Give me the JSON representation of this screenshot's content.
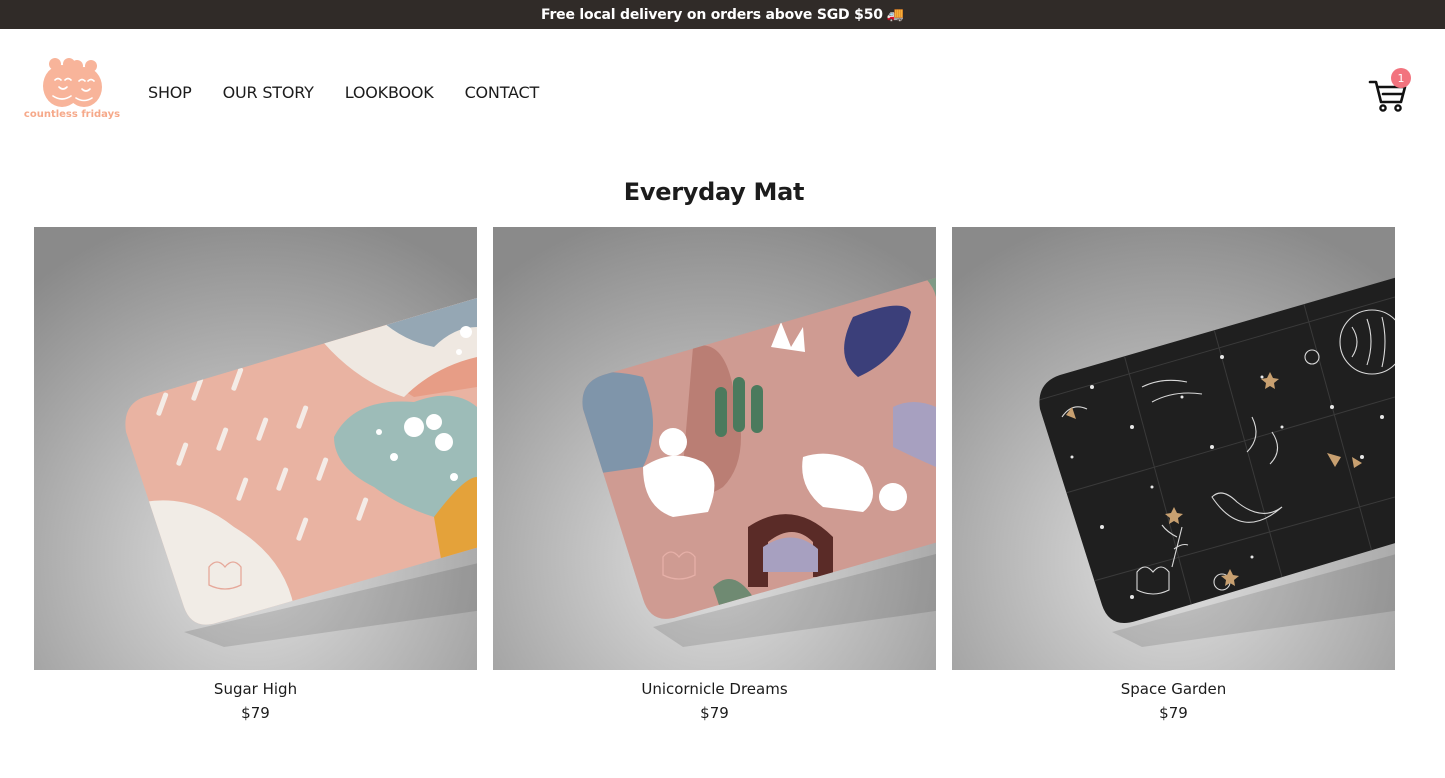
{
  "announcement": {
    "text": "Free local delivery on orders above SGD $50",
    "emoji": "🚚"
  },
  "brand": {
    "name": "countless fridays",
    "accent": "#f6a98a"
  },
  "nav": {
    "items": [
      "SHOP",
      "OUR STORY",
      "LOOKBOOK",
      "CONTACT"
    ]
  },
  "cart": {
    "count": "1",
    "badge_color": "#f2737e"
  },
  "page": {
    "title": "Everyday Mat"
  },
  "products": [
    {
      "name": "Sugar High",
      "price": "$79",
      "image": "sugar-high-mat"
    },
    {
      "name": "Unicornicle Dreams",
      "price": "$79",
      "image": "unicornicle-dreams-mat"
    },
    {
      "name": "Space Garden",
      "price": "$79",
      "image": "space-garden-mat"
    }
  ]
}
